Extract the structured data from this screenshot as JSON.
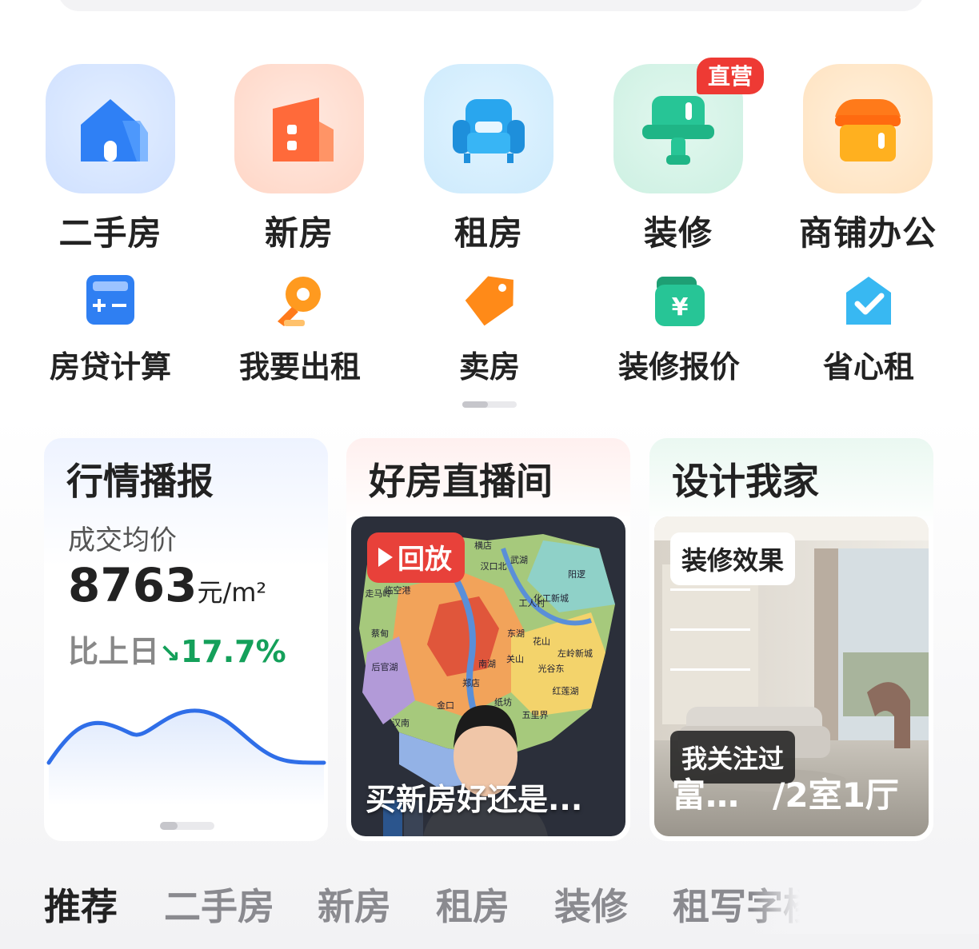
{
  "main_nav": [
    {
      "label": "二手房",
      "icon": "house-icon"
    },
    {
      "label": "新房",
      "icon": "building-icon"
    },
    {
      "label": "租房",
      "icon": "sofa-icon"
    },
    {
      "label": "装修",
      "icon": "paint-roller-icon",
      "badge": "直营"
    },
    {
      "label": "商铺办公",
      "icon": "shop-icon"
    }
  ],
  "sub_nav": [
    {
      "label": "房贷计算",
      "icon": "calculator-icon"
    },
    {
      "label": "我要出租",
      "icon": "key-icon"
    },
    {
      "label": "卖房",
      "icon": "price-tag-icon"
    },
    {
      "label": "装修报价",
      "icon": "yen-wallet-icon"
    },
    {
      "label": "省心租",
      "icon": "check-house-icon"
    }
  ],
  "market_card": {
    "title": "行情播报",
    "price_label": "成交均价",
    "price": "8763",
    "unit": "元/m²",
    "trend_label": "比上日",
    "trend_arrow": "↘",
    "trend_value": "17.7%",
    "trend_color": "#14a05a"
  },
  "live_card": {
    "title": "好房直播间",
    "replay_label": "回放",
    "caption": "买新房好还是...",
    "map_labels": [
      "横店",
      "武湖",
      "阳逻",
      "汉口北",
      "临空港",
      "走马岭",
      "工人村",
      "化工新城",
      "蔡甸",
      "东湖",
      "后官湖",
      "花山",
      "左岭新城",
      "南湖",
      "关山",
      "光谷东",
      "红莲湖",
      "金口",
      "五里界",
      "汉南",
      "郑店",
      "纸坊"
    ]
  },
  "design_card": {
    "title": "设计我家",
    "tag_top": "装修效果",
    "tag_bottom": "我关注过",
    "caption": "富…　/2室1厅"
  },
  "tabs": [
    "推荐",
    "二手房",
    "新房",
    "租房",
    "装修",
    "租写字楼"
  ],
  "active_tab": 0
}
